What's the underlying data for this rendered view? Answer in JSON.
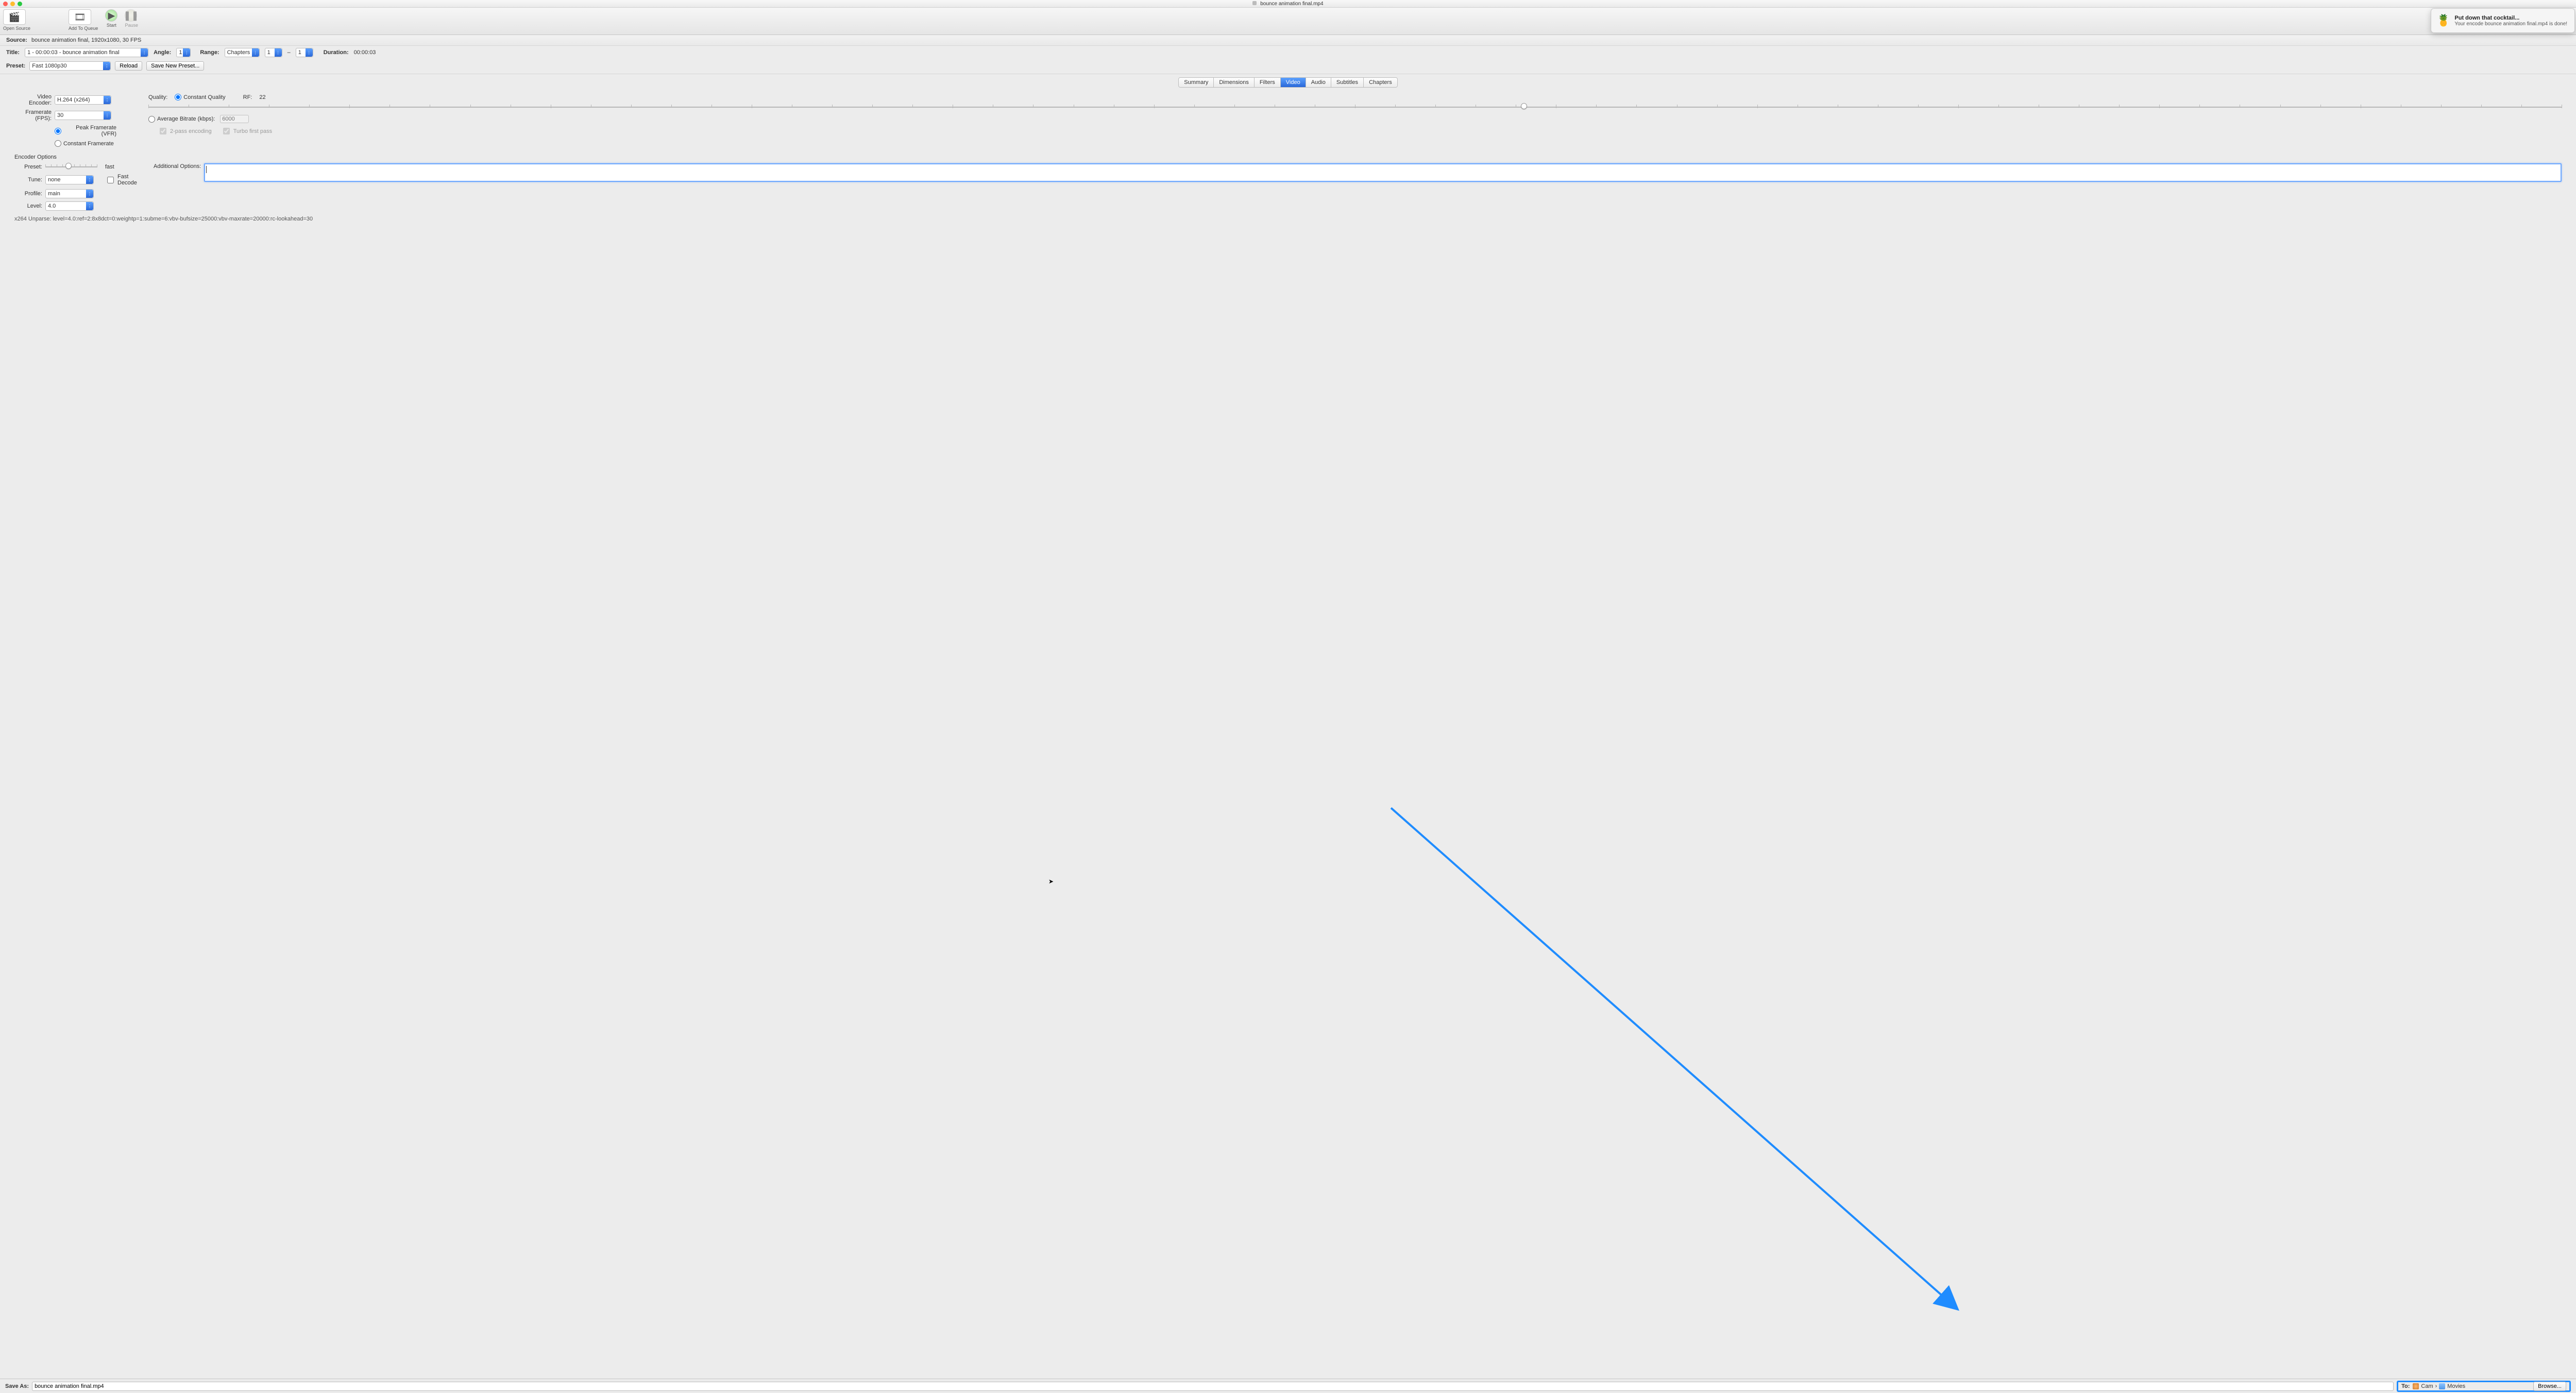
{
  "window": {
    "title": "bounce animation final.mp4"
  },
  "toolbar": {
    "open_source": "Open Source",
    "add_to_queue": "Add To Queue",
    "start": "Start",
    "pause": "Pause"
  },
  "source": {
    "label": "Source:",
    "value": "bounce animation final, 1920x1080, 30 FPS"
  },
  "title": {
    "label": "Title:",
    "value": "1 - 00:00:03 - bounce animation final"
  },
  "angle": {
    "label": "Angle:",
    "value": "1"
  },
  "range": {
    "label": "Range:",
    "mode": "Chapters",
    "from": "1",
    "to": "1",
    "sep": "–"
  },
  "duration": {
    "label": "Duration:",
    "value": "00:00:03"
  },
  "preset": {
    "label": "Preset:",
    "value": "Fast 1080p30",
    "reload": "Reload",
    "save_new": "Save New Preset..."
  },
  "tabs": [
    "Summary",
    "Dimensions",
    "Filters",
    "Video",
    "Audio",
    "Subtitles",
    "Chapters"
  ],
  "video": {
    "encoder_label": "Video Encoder:",
    "encoder_value": "H.264 (x264)",
    "fps_label": "Framerate (FPS):",
    "fps_value": "30",
    "peak": "Peak Framerate (VFR)",
    "constant": "Constant Framerate",
    "quality_label": "Quality:",
    "cq_label": "Constant Quality",
    "rf_label": "RF:",
    "rf_value": "22",
    "avg_label": "Average Bitrate (kbps):",
    "avg_value": "6000",
    "twop": "2-pass encoding",
    "turbo": "Turbo first pass"
  },
  "encoder_opts": {
    "heading": "Encoder Options",
    "preset_label": "Preset:",
    "preset_value_label": "fast",
    "tune_label": "Tune:",
    "tune_value": "none",
    "fastdecode_label": "Fast Decode",
    "profile_label": "Profile:",
    "profile_value": "main",
    "level_label": "Level:",
    "level_value": "4.0",
    "additional_label": "Additional Options:"
  },
  "unparse": "x264 Unparse: level=4.0:ref=2:8x8dct=0:weightp=1:subme=6:vbv-bufsize=25000:vbv-maxrate=20000:rc-lookahead=30",
  "saveas": {
    "label": "Save As:",
    "value": "bounce animation final.mp4"
  },
  "to": {
    "label": "To:",
    "path": [
      "Cam",
      "Movies"
    ],
    "sep": "›",
    "browse": "Browse..."
  },
  "notification": {
    "icon": "🍍🍹",
    "title": "Put down that cocktail...",
    "body": "Your encode bounce animation final.mp4 is done!"
  }
}
